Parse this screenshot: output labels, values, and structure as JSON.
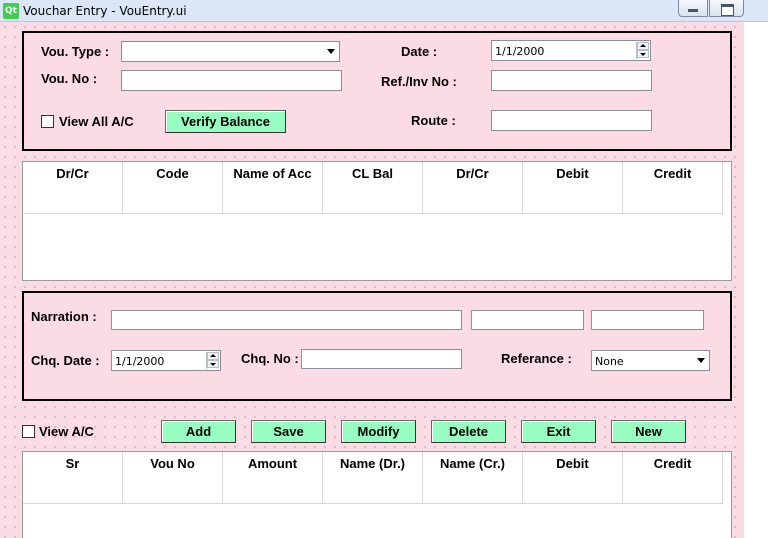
{
  "window": {
    "title": "Vouchar Entry - VouEntry.ui",
    "logo": "Qt"
  },
  "header": {
    "vou_type_label": "Vou. Type :",
    "vou_type_value": "",
    "vou_no_label": "Vou. No :",
    "vou_no_value": "",
    "view_all_label": "View All A/C",
    "verify_label": "Verify Balance",
    "date_label": "Date :",
    "date_value": "1/1/2000",
    "ref_label": "Ref./Inv No :",
    "ref_value": "",
    "route_label": "Route :",
    "route_value": ""
  },
  "top_table": {
    "columns": [
      "Dr/Cr",
      "Code",
      "Name of Acc",
      "CL Bal",
      "Dr/Cr",
      "Debit",
      "Credit"
    ],
    "rows": []
  },
  "narration": {
    "narration_label": "Narration :",
    "chq_date_label": "Chq. Date :",
    "chq_date_value": "1/1/2000",
    "chq_no_label": "Chq. No :",
    "referance_label": "Referance :",
    "referance_value": "None"
  },
  "actions": {
    "view_ac_label": "View A/C",
    "add": "Add",
    "save": "Save",
    "modify": "Modify",
    "delete": "Delete",
    "exit": "Exit",
    "new": "New"
  },
  "bottom_table": {
    "columns": [
      "Sr",
      "Vou No",
      "Amount",
      "Name (Dr.)",
      "Name (Cr.)",
      "Debit",
      "Credit"
    ],
    "rows": []
  },
  "colors": {
    "form_background": "#fcdce4",
    "button_background": "#97fdc0",
    "panel_border": "#000000"
  }
}
